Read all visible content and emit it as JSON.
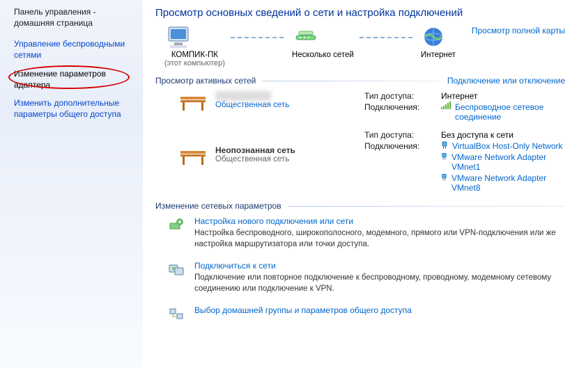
{
  "sidebar": {
    "home": "Панель управления - домашняя страница",
    "links": [
      "Управление беспроводными сетями",
      "Изменение параметров адаптера",
      "Изменить дополнительные параметры общего доступа"
    ]
  },
  "header": {
    "title": "Просмотр основных сведений о сети и настройка подключений",
    "map_link": "Просмотр полной карты",
    "pc_name": "КОМПИК-ПК",
    "pc_sub": "(этот компьютер)",
    "mid_label": "Несколько сетей",
    "internet_label": "Интернет"
  },
  "active": {
    "title": "Просмотр активных сетей",
    "toggle_link": "Подключение или отключение",
    "net1": {
      "type": "Общественная сеть",
      "access_label": "Тип доступа:",
      "access_value": "Интернет",
      "conn_label": "Подключения:",
      "conn_value": "Беспроводное сетевое соединение"
    },
    "net2": {
      "name": "Неопознанная сеть",
      "type": "Общественная сеть",
      "access_label": "Тип доступа:",
      "access_value": "Без доступа к сети",
      "conn_label": "Подключения:",
      "conns": [
        "VirtualBox Host-Only Network",
        "VMware Network Adapter VMnet1",
        "VMware Network Adapter VMnet8"
      ]
    }
  },
  "change": {
    "title": "Изменение сетевых параметров",
    "tasks": [
      {
        "title": "Настройка нового подключения или сети",
        "desc": "Настройка беспроводного, широкополосного, модемного, прямого или VPN-подключения или же настройка маршрутизатора или точки доступа."
      },
      {
        "title": "Подключиться к сети",
        "desc": "Подключение или повторное подключение к беспроводному, проводному, модемному сетевому соединению или подключение к VPN."
      },
      {
        "title": "Выбор домашней группы и параметров общего доступа",
        "desc": ""
      }
    ]
  }
}
